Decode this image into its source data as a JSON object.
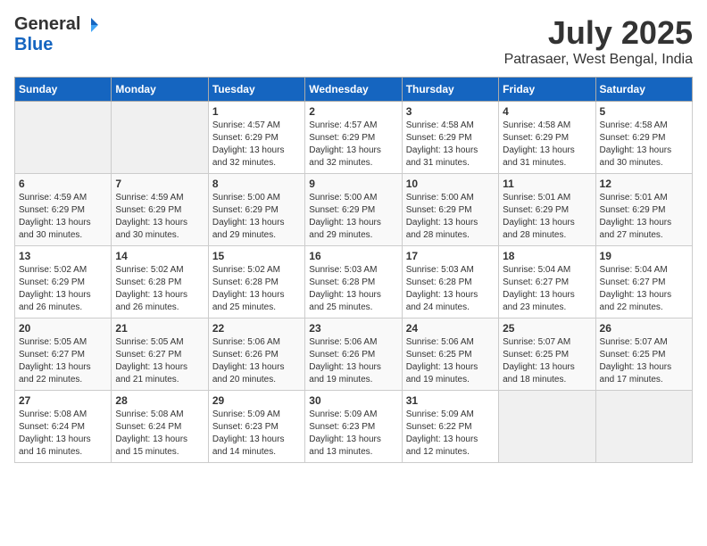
{
  "logo": {
    "general": "General",
    "blue": "Blue"
  },
  "title": "July 2025",
  "location": "Patrasaer, West Bengal, India",
  "days_of_week": [
    "Sunday",
    "Monday",
    "Tuesday",
    "Wednesday",
    "Thursday",
    "Friday",
    "Saturday"
  ],
  "weeks": [
    [
      {
        "day": "",
        "info": ""
      },
      {
        "day": "",
        "info": ""
      },
      {
        "day": "1",
        "info": "Sunrise: 4:57 AM\nSunset: 6:29 PM\nDaylight: 13 hours\nand 32 minutes."
      },
      {
        "day": "2",
        "info": "Sunrise: 4:57 AM\nSunset: 6:29 PM\nDaylight: 13 hours\nand 32 minutes."
      },
      {
        "day": "3",
        "info": "Sunrise: 4:58 AM\nSunset: 6:29 PM\nDaylight: 13 hours\nand 31 minutes."
      },
      {
        "day": "4",
        "info": "Sunrise: 4:58 AM\nSunset: 6:29 PM\nDaylight: 13 hours\nand 31 minutes."
      },
      {
        "day": "5",
        "info": "Sunrise: 4:58 AM\nSunset: 6:29 PM\nDaylight: 13 hours\nand 30 minutes."
      }
    ],
    [
      {
        "day": "6",
        "info": "Sunrise: 4:59 AM\nSunset: 6:29 PM\nDaylight: 13 hours\nand 30 minutes."
      },
      {
        "day": "7",
        "info": "Sunrise: 4:59 AM\nSunset: 6:29 PM\nDaylight: 13 hours\nand 30 minutes."
      },
      {
        "day": "8",
        "info": "Sunrise: 5:00 AM\nSunset: 6:29 PM\nDaylight: 13 hours\nand 29 minutes."
      },
      {
        "day": "9",
        "info": "Sunrise: 5:00 AM\nSunset: 6:29 PM\nDaylight: 13 hours\nand 29 minutes."
      },
      {
        "day": "10",
        "info": "Sunrise: 5:00 AM\nSunset: 6:29 PM\nDaylight: 13 hours\nand 28 minutes."
      },
      {
        "day": "11",
        "info": "Sunrise: 5:01 AM\nSunset: 6:29 PM\nDaylight: 13 hours\nand 28 minutes."
      },
      {
        "day": "12",
        "info": "Sunrise: 5:01 AM\nSunset: 6:29 PM\nDaylight: 13 hours\nand 27 minutes."
      }
    ],
    [
      {
        "day": "13",
        "info": "Sunrise: 5:02 AM\nSunset: 6:29 PM\nDaylight: 13 hours\nand 26 minutes."
      },
      {
        "day": "14",
        "info": "Sunrise: 5:02 AM\nSunset: 6:28 PM\nDaylight: 13 hours\nand 26 minutes."
      },
      {
        "day": "15",
        "info": "Sunrise: 5:02 AM\nSunset: 6:28 PM\nDaylight: 13 hours\nand 25 minutes."
      },
      {
        "day": "16",
        "info": "Sunrise: 5:03 AM\nSunset: 6:28 PM\nDaylight: 13 hours\nand 25 minutes."
      },
      {
        "day": "17",
        "info": "Sunrise: 5:03 AM\nSunset: 6:28 PM\nDaylight: 13 hours\nand 24 minutes."
      },
      {
        "day": "18",
        "info": "Sunrise: 5:04 AM\nSunset: 6:27 PM\nDaylight: 13 hours\nand 23 minutes."
      },
      {
        "day": "19",
        "info": "Sunrise: 5:04 AM\nSunset: 6:27 PM\nDaylight: 13 hours\nand 22 minutes."
      }
    ],
    [
      {
        "day": "20",
        "info": "Sunrise: 5:05 AM\nSunset: 6:27 PM\nDaylight: 13 hours\nand 22 minutes."
      },
      {
        "day": "21",
        "info": "Sunrise: 5:05 AM\nSunset: 6:27 PM\nDaylight: 13 hours\nand 21 minutes."
      },
      {
        "day": "22",
        "info": "Sunrise: 5:06 AM\nSunset: 6:26 PM\nDaylight: 13 hours\nand 20 minutes."
      },
      {
        "day": "23",
        "info": "Sunrise: 5:06 AM\nSunset: 6:26 PM\nDaylight: 13 hours\nand 19 minutes."
      },
      {
        "day": "24",
        "info": "Sunrise: 5:06 AM\nSunset: 6:25 PM\nDaylight: 13 hours\nand 19 minutes."
      },
      {
        "day": "25",
        "info": "Sunrise: 5:07 AM\nSunset: 6:25 PM\nDaylight: 13 hours\nand 18 minutes."
      },
      {
        "day": "26",
        "info": "Sunrise: 5:07 AM\nSunset: 6:25 PM\nDaylight: 13 hours\nand 17 minutes."
      }
    ],
    [
      {
        "day": "27",
        "info": "Sunrise: 5:08 AM\nSunset: 6:24 PM\nDaylight: 13 hours\nand 16 minutes."
      },
      {
        "day": "28",
        "info": "Sunrise: 5:08 AM\nSunset: 6:24 PM\nDaylight: 13 hours\nand 15 minutes."
      },
      {
        "day": "29",
        "info": "Sunrise: 5:09 AM\nSunset: 6:23 PM\nDaylight: 13 hours\nand 14 minutes."
      },
      {
        "day": "30",
        "info": "Sunrise: 5:09 AM\nSunset: 6:23 PM\nDaylight: 13 hours\nand 13 minutes."
      },
      {
        "day": "31",
        "info": "Sunrise: 5:09 AM\nSunset: 6:22 PM\nDaylight: 13 hours\nand 12 minutes."
      },
      {
        "day": "",
        "info": ""
      },
      {
        "day": "",
        "info": ""
      }
    ]
  ]
}
